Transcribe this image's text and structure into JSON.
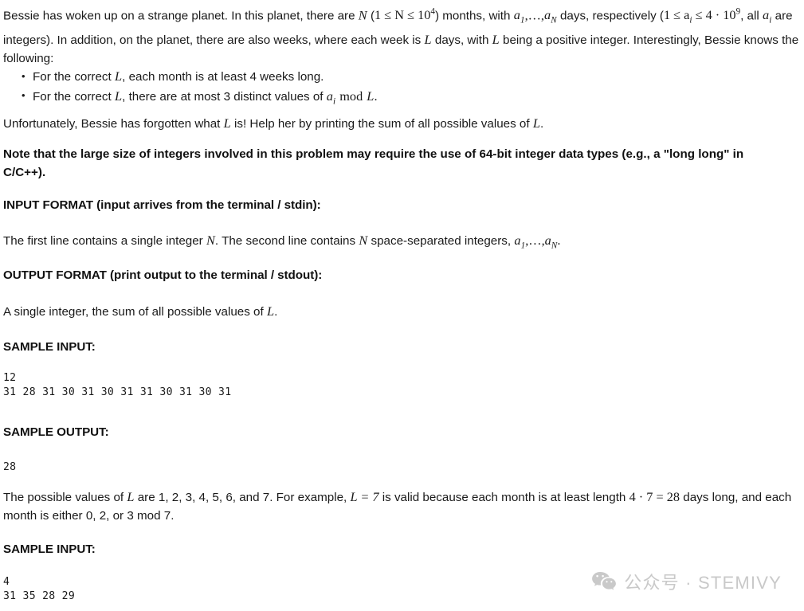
{
  "document": {
    "type": "competitive-programming-problem-statement",
    "intro": {
      "part1": "Bessie has woken up on a strange planet. In this planet, there are ",
      "var_n": "N",
      "part2": " (",
      "constraint_n": "1 ≤ N ≤ 10",
      "constraint_n_exp": "4",
      "part3": ") months, with ",
      "seq": "a",
      "seq_sub1": "1",
      "seq_mid": ",…,",
      "seq2": "a",
      "seq_sub2": "N",
      "part4": " days, respectively (",
      "constraint_a_1": "1 ≤ a",
      "constraint_a_sub": "i",
      "constraint_a_2": " ≤ 4 · 10",
      "constraint_a_exp": "9",
      "part5": ", all ",
      "var_ai": "a",
      "var_ai_sub": "i",
      "part6": " are integers). In addition, on the planet, there are also weeks, where each week is ",
      "var_l_1": "L",
      "part7": " days, with ",
      "var_l_2": "L",
      "part8": " being a positive integer. Interestingly, Bessie knows the following:"
    },
    "bullets": [
      {
        "pre": "For the correct ",
        "var": "L",
        "post": ", each month is at least 4 weeks long."
      },
      {
        "pre": "For the correct ",
        "var": "L",
        "post": ", there are at most 3 distinct values of ",
        "tail_var": "a",
        "tail_sub": "i",
        "tail_op": " mod ",
        "tail_var2": "L",
        "tail_end": "."
      }
    ],
    "forgotten": {
      "pre": "Unfortunately, Bessie has forgotten what ",
      "var1": "L",
      "mid": " is! Help her by printing the sum of all possible values of ",
      "var2": "L",
      "end": "."
    },
    "note": "Note that the large size of integers involved in this problem may require the use of 64-bit integer data types (e.g., a \"long long\" in C/C++).",
    "input_format_heading": "INPUT FORMAT (input arrives from the terminal / stdin):",
    "input_format_desc": {
      "part1": "The first line contains a single integer ",
      "var_n1": "N",
      "part2": ". The second line contains ",
      "var_n2": "N",
      "part3": " space-separated integers, ",
      "seq": "a",
      "seq_sub1": "1",
      "seq_mid": ",…,",
      "seq2": "a",
      "seq_sub2": "N",
      "part4": "."
    },
    "output_format_heading": "OUTPUT FORMAT (print output to the terminal / stdout):",
    "output_format_desc": {
      "pre": "A single integer, the sum of all possible values of ",
      "var": "L",
      "end": "."
    },
    "sample_input_heading_1": "SAMPLE INPUT:",
    "sample_input_1": "12\n31 28 31 30 31 30 31 31 30 31 30 31",
    "sample_output_heading_1": "SAMPLE OUTPUT:",
    "sample_output_1": "28",
    "explanation": {
      "part1": "The possible values of ",
      "var_l1": "L",
      "part2": " are 1, 2, 3, 4, 5, 6, and 7. For example, ",
      "eq_l": "L = 7",
      "part3": " is valid because each month is at least length ",
      "eq_calc": "4 · 7 = 28",
      "part4": " days long, and each month is either 0, 2, or 3 mod 7."
    },
    "sample_input_heading_2": "SAMPLE INPUT:",
    "sample_input_2": "4\n31 35 28 29"
  },
  "watermark": {
    "icon": "wechat-icon",
    "text": "公众号 · STEMIVY",
    "color": "#c9c9c9"
  },
  "colors": {
    "background": "#ffffff",
    "body_text": "#1a1a1a",
    "heading_text": "#111111",
    "watermark": "#c9c9c9"
  }
}
